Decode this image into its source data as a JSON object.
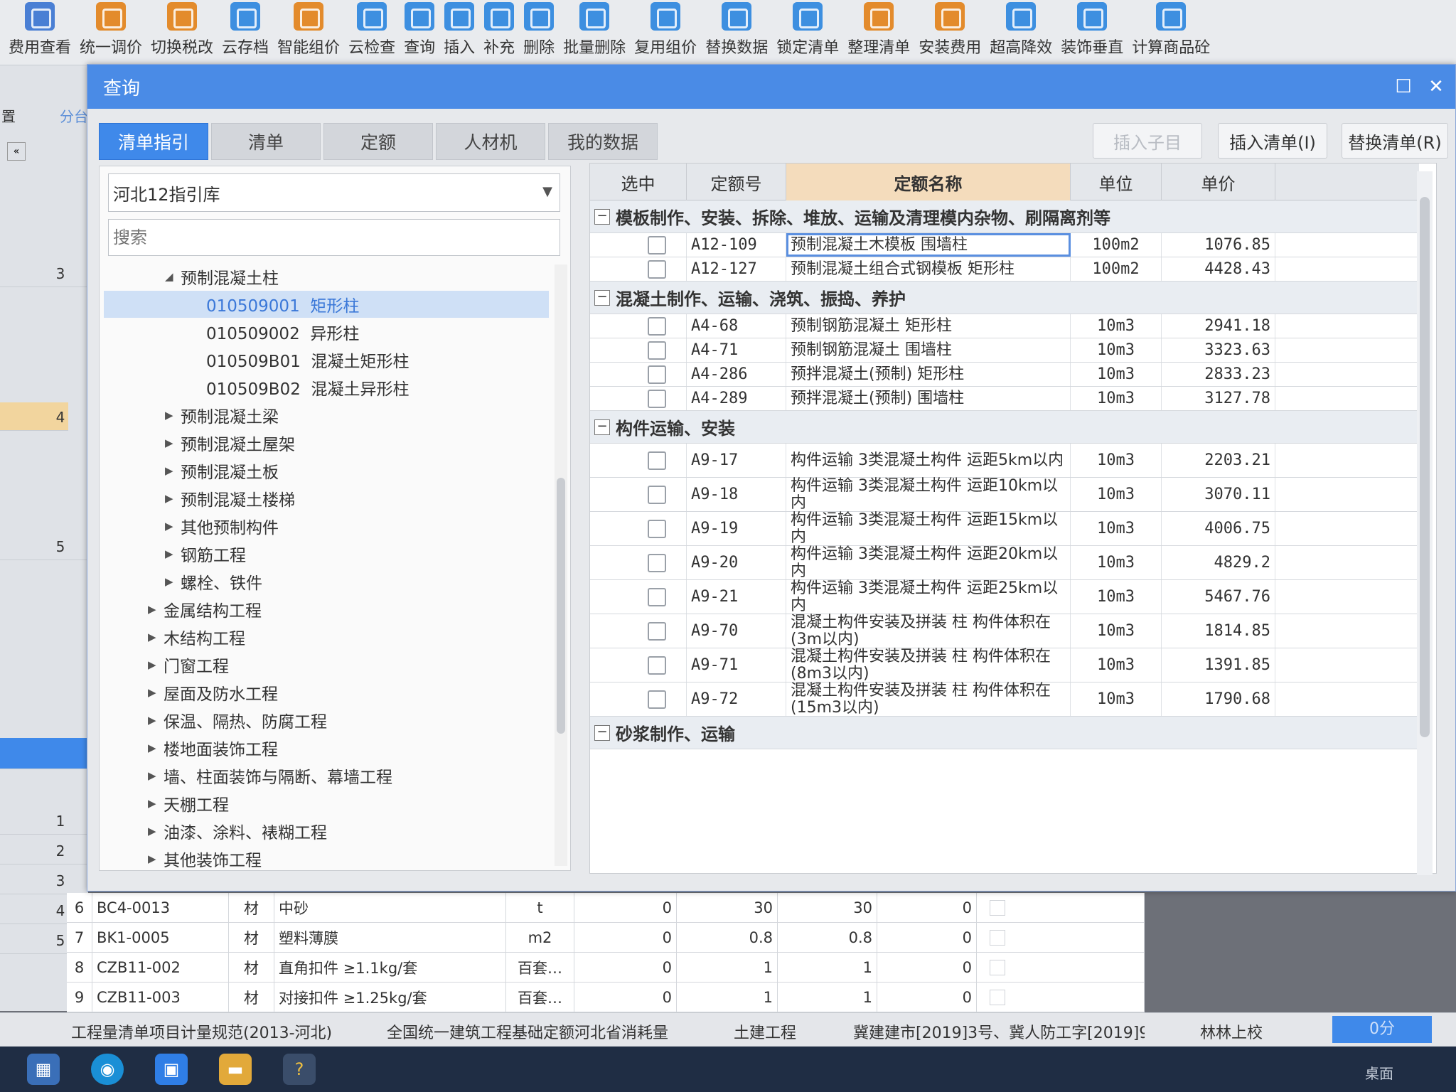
{
  "ribbon": [
    {
      "label": "费用查看",
      "icon": "fee-view-icon",
      "color": "#4a7fd4"
    },
    {
      "label": "统一调价",
      "icon": "adjust-price-icon",
      "color": "#e38b2c"
    },
    {
      "label": "切换税改",
      "icon": "tax-switch-icon",
      "color": "#e38b2c"
    },
    {
      "label": "云存档",
      "icon": "cloud-save-icon",
      "color": "#3d8fe0"
    },
    {
      "label": "智能组价",
      "icon": "smart-price-icon",
      "color": "#e38b2c"
    },
    {
      "label": "云检查",
      "icon": "cloud-check-icon",
      "color": "#3d8fe0"
    },
    {
      "label": "查询",
      "icon": "query-icon",
      "color": "#3d8fe0"
    },
    {
      "label": "插入",
      "icon": "insert-icon",
      "color": "#3d8fe0"
    },
    {
      "label": "补充",
      "icon": "supplement-icon",
      "color": "#3d8fe0"
    },
    {
      "label": "删除",
      "icon": "delete-icon",
      "color": "#3d8fe0"
    },
    {
      "label": "批量删除",
      "icon": "batch-delete-icon",
      "color": "#3d8fe0"
    },
    {
      "label": "复用组价",
      "icon": "reuse-price-icon",
      "color": "#3d8fe0"
    },
    {
      "label": "替换数据",
      "icon": "replace-data-icon",
      "color": "#3d8fe0"
    },
    {
      "label": "锁定清单",
      "icon": "lock-icon",
      "color": "#3d8fe0"
    },
    {
      "label": "整理清单",
      "icon": "organize-icon",
      "color": "#e38b2c"
    },
    {
      "label": "安装费用",
      "icon": "install-fee-icon",
      "color": "#e38b2c"
    },
    {
      "label": "超高降效",
      "icon": "height-icon",
      "color": "#3d8fe0"
    },
    {
      "label": "装饰垂直",
      "icon": "decor-icon",
      "color": "#3d8fe0"
    },
    {
      "label": "计算商品砼",
      "icon": "calc-concrete-icon",
      "color": "#3d8fe0"
    }
  ],
  "dialog": {
    "title": "查询",
    "tabs": [
      "清单指引",
      "清单",
      "定额",
      "人材机",
      "我的数据"
    ],
    "buttons": {
      "insert_child": "插入子目",
      "insert_list": "插入清单(I)",
      "replace_list": "替换清单(R)"
    },
    "library": "河北12指引库",
    "search_placeholder": "搜索"
  },
  "tree": [
    {
      "label": "预制混凝土柱",
      "level": 2,
      "expanded": true
    },
    {
      "label": "010509001  矩形柱",
      "level": 3,
      "selected": true
    },
    {
      "label": "010509002  异形柱",
      "level": 3
    },
    {
      "label": "010509B01  混凝土矩形柱",
      "level": 3
    },
    {
      "label": "010509B02  混凝土异形柱",
      "level": 3
    },
    {
      "label": "预制混凝土梁",
      "level": 2
    },
    {
      "label": "预制混凝土屋架",
      "level": 2
    },
    {
      "label": "预制混凝土板",
      "level": 2
    },
    {
      "label": "预制混凝土楼梯",
      "level": 2
    },
    {
      "label": "其他预制构件",
      "level": 2
    },
    {
      "label": "钢筋工程",
      "level": 2
    },
    {
      "label": "螺栓、铁件",
      "level": 2
    },
    {
      "label": "金属结构工程",
      "level": 1
    },
    {
      "label": "木结构工程",
      "level": 1
    },
    {
      "label": "门窗工程",
      "level": 1
    },
    {
      "label": "屋面及防水工程",
      "level": 1
    },
    {
      "label": "保温、隔热、防腐工程",
      "level": 1
    },
    {
      "label": "楼地面装饰工程",
      "level": 1
    },
    {
      "label": "墙、柱面装饰与隔断、幕墙工程",
      "level": 1
    },
    {
      "label": "天棚工程",
      "level": 1
    },
    {
      "label": "油漆、涂料、裱糊工程",
      "level": 1
    },
    {
      "label": "其他装饰工程",
      "level": 1
    }
  ],
  "grid": {
    "headers": [
      "选中",
      "定额号",
      "定额名称",
      "单位",
      "单价"
    ],
    "rows": [
      {
        "type": "group",
        "title": "模板制作、安装、拆除、堆放、运输及清理模内杂物、刷隔离剂等"
      },
      {
        "type": "item",
        "code": "A12-109",
        "name": "预制混凝土木模板 围墙柱",
        "unit": "100m2",
        "price": "1076.85",
        "focus": true
      },
      {
        "type": "item",
        "code": "A12-127",
        "name": "预制混凝土组合式钢模板 矩形柱",
        "unit": "100m2",
        "price": "4428.43"
      },
      {
        "type": "group",
        "title": "混凝土制作、运输、浇筑、振捣、养护"
      },
      {
        "type": "item",
        "code": "A4-68",
        "name": "预制钢筋混凝土 矩形柱",
        "unit": "10m3",
        "price": "2941.18"
      },
      {
        "type": "item",
        "code": "A4-71",
        "name": "预制钢筋混凝土 围墙柱",
        "unit": "10m3",
        "price": "3323.63"
      },
      {
        "type": "item",
        "code": "A4-286",
        "name": "预拌混凝土(预制) 矩形柱",
        "unit": "10m3",
        "price": "2833.23"
      },
      {
        "type": "item",
        "code": "A4-289",
        "name": "预拌混凝土(预制) 围墙柱",
        "unit": "10m3",
        "price": "3127.78"
      },
      {
        "type": "group",
        "title": "构件运输、安装"
      },
      {
        "type": "item",
        "tall": true,
        "code": "A9-17",
        "name": "构件运输 3类混凝土构件 运距5km以内",
        "unit": "10m3",
        "price": "2203.21"
      },
      {
        "type": "item",
        "tall": true,
        "code": "A9-18",
        "name": "构件运输 3类混凝土构件 运距10km以内",
        "unit": "10m3",
        "price": "3070.11"
      },
      {
        "type": "item",
        "tall": true,
        "code": "A9-19",
        "name": "构件运输 3类混凝土构件 运距15km以内",
        "unit": "10m3",
        "price": "4006.75"
      },
      {
        "type": "item",
        "tall": true,
        "code": "A9-20",
        "name": "构件运输 3类混凝土构件 运距20km以内",
        "unit": "10m3",
        "price": "4829.2"
      },
      {
        "type": "item",
        "tall": true,
        "code": "A9-21",
        "name": "构件运输 3类混凝土构件 运距25km以内",
        "unit": "10m3",
        "price": "5467.76"
      },
      {
        "type": "item",
        "tall": true,
        "code": "A9-70",
        "name": "混凝土构件安装及拼装 柱 构件体积在(3m以内)",
        "unit": "10m3",
        "price": "1814.85"
      },
      {
        "type": "item",
        "tall": true,
        "code": "A9-71",
        "name": "混凝土构件安装及拼装 柱 构件体积在(8m3以内)",
        "unit": "10m3",
        "price": "1391.85"
      },
      {
        "type": "item",
        "tall": true,
        "code": "A9-72",
        "name": "混凝土构件安装及拼装 柱 构件体积在(15m3以内)",
        "unit": "10m3",
        "price": "1790.68"
      },
      {
        "type": "group",
        "title": "砂浆制作、运输"
      }
    ]
  },
  "leftstrip": {
    "labels": [
      "置",
      "分台",
      "3",
      "4",
      "5",
      "1",
      "2",
      "3",
      "4",
      "5"
    ]
  },
  "bottom_rows": [
    {
      "num": "6",
      "code": "BC4-0013",
      "kind": "材",
      "name": "中砂",
      "unit": "t",
      "v1": "0",
      "v2": "30",
      "v3": "30",
      "v4": "0"
    },
    {
      "num": "7",
      "code": "BK1-0005",
      "kind": "材",
      "name": "塑料薄膜",
      "unit": "m2",
      "v1": "0",
      "v2": "0.8",
      "v3": "0.8",
      "v4": "0"
    },
    {
      "num": "8",
      "code": "CZB11-002",
      "kind": "材",
      "name": "直角扣件 ≥1.1kg/套",
      "unit": "百套…",
      "v1": "0",
      "v2": "1",
      "v3": "1",
      "v4": "0"
    },
    {
      "num": "9",
      "code": "CZB11-003",
      "kind": "材",
      "name": "对接扣件 ≥1.25kg/套",
      "unit": "百套…",
      "v1": "0",
      "v2": "1",
      "v3": "1",
      "v4": "0"
    }
  ],
  "status": {
    "s1": "工程量清单项目计量规范(2013-河北)",
    "s2": "全国统一建筑工程基础定额河北省消耗量",
    "s3": "土建工程",
    "s4": "冀建建市[2019]3号、冀人防工字[2019]9",
    "s5": "林林上校",
    "s6": "0分"
  },
  "taskbar": {
    "desktop": "桌面"
  }
}
